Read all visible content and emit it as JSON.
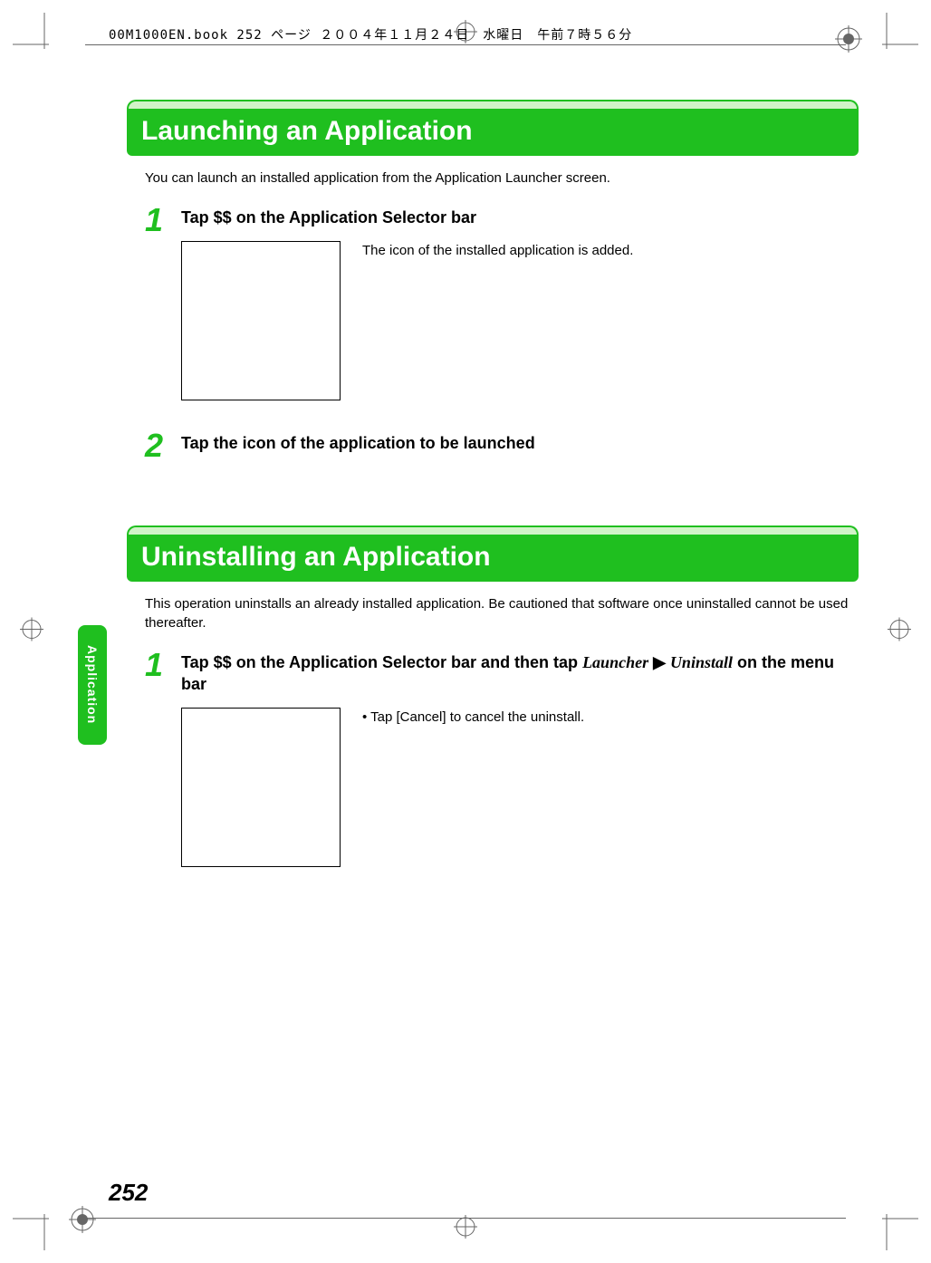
{
  "header": {
    "running_head": "00M1000EN.book  252 ページ  ２００４年１１月２４日　水曜日　午前７時５６分"
  },
  "side_tab": "Application",
  "page_number": "252",
  "sections": [
    {
      "heading": "Launching an Application",
      "intro": "You can launch an installed application from the Application Launcher screen.",
      "steps": [
        {
          "num": "1",
          "title_parts": {
            "a": "Tap $$ on the Application Selector bar"
          },
          "note": "The icon of the installed application is added."
        },
        {
          "num": "2",
          "title_parts": {
            "a": "Tap the icon of the application to be launched"
          }
        }
      ]
    },
    {
      "heading": "Uninstalling an Application",
      "intro": "This operation uninstalls an already installed application. Be cautioned that software once uninstalled cannot be used thereafter.",
      "steps": [
        {
          "num": "1",
          "title_parts": {
            "a": "Tap $$ on the Application Selector bar and then tap ",
            "italic1": "Launcher",
            "arrow": " ▶ ",
            "italic2": "Uninstall",
            "b": " on the menu bar"
          },
          "bullet": "•  Tap [Cancel] to cancel the uninstall."
        }
      ]
    }
  ]
}
